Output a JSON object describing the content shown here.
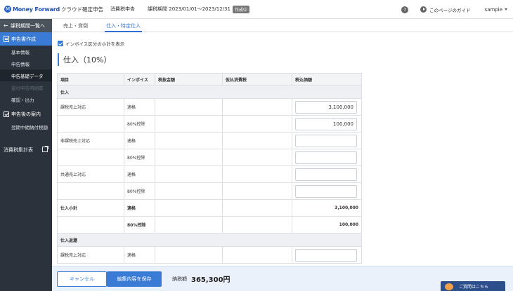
{
  "header": {
    "brand_mark": "M",
    "brand_name": "Money Forward",
    "product": "クラウド確定申告",
    "sub_product": "消費税申告",
    "period": "課税期間 2023/01/01〜2023/12/31",
    "status_badge": "作成中",
    "guide_label": "このページのガイド",
    "user_name": "sample",
    "help_icon": "?"
  },
  "sidebar": {
    "back_label": "課税期間一覧へ",
    "section_label": "申告書作成",
    "items": [
      {
        "label": "基本情報"
      },
      {
        "label": "申告情報"
      },
      {
        "label": "申告基礎データ"
      },
      {
        "label": "還付申告明細書"
      },
      {
        "label": "確認・出力"
      }
    ],
    "after_section_label": "申告後の案内",
    "after_items": [
      {
        "label": "翌期中間納付税額"
      }
    ],
    "external_label": "消費税集計表"
  },
  "tabs": [
    {
      "label": "売上・貸倒"
    },
    {
      "label": "仕入・特定仕入"
    }
  ],
  "invoice_checkbox_label": "インボイス区分の小計を表示",
  "section_title": "仕入（10%）",
  "table": {
    "headers": [
      "項目",
      "インボイス",
      "税抜金額",
      "仮払消費税",
      "税込価額"
    ],
    "groups": {
      "purchase": "仕入",
      "purchase_returns": "仕入返還"
    },
    "rows": {
      "r1": {
        "item": "課税売上対応",
        "invoice": "適格",
        "amount": "3,100,000"
      },
      "r2": {
        "invoice": "80%控除",
        "amount": "100,000"
      },
      "r3": {
        "item": "非課税売上対応",
        "invoice": "適格",
        "amount": ""
      },
      "r4": {
        "invoice": "80%控除",
        "amount": ""
      },
      "r5": {
        "item": "共通売上対応",
        "invoice": "適格",
        "amount": ""
      },
      "r6": {
        "invoice": "80%控除",
        "amount": ""
      },
      "sub1": {
        "item": "仕入小計",
        "invoice": "適格",
        "amount": "3,100,000"
      },
      "sub2": {
        "invoice": "80%控除",
        "amount": "100,000"
      },
      "ret1": {
        "item": "課税売上対応",
        "invoice": "適格",
        "amount": ""
      }
    }
  },
  "footer": {
    "cancel_label": "キャンセル",
    "save_label": "編集内容を保存",
    "tax_label": "納税額",
    "tax_amount": "365,300円",
    "chat_label": "ご質問はこちら"
  },
  "colors": {
    "accent": "#3a7bd5",
    "sidebar_bg": "#2b323b",
    "footer_bg": "#eaf1fb"
  }
}
